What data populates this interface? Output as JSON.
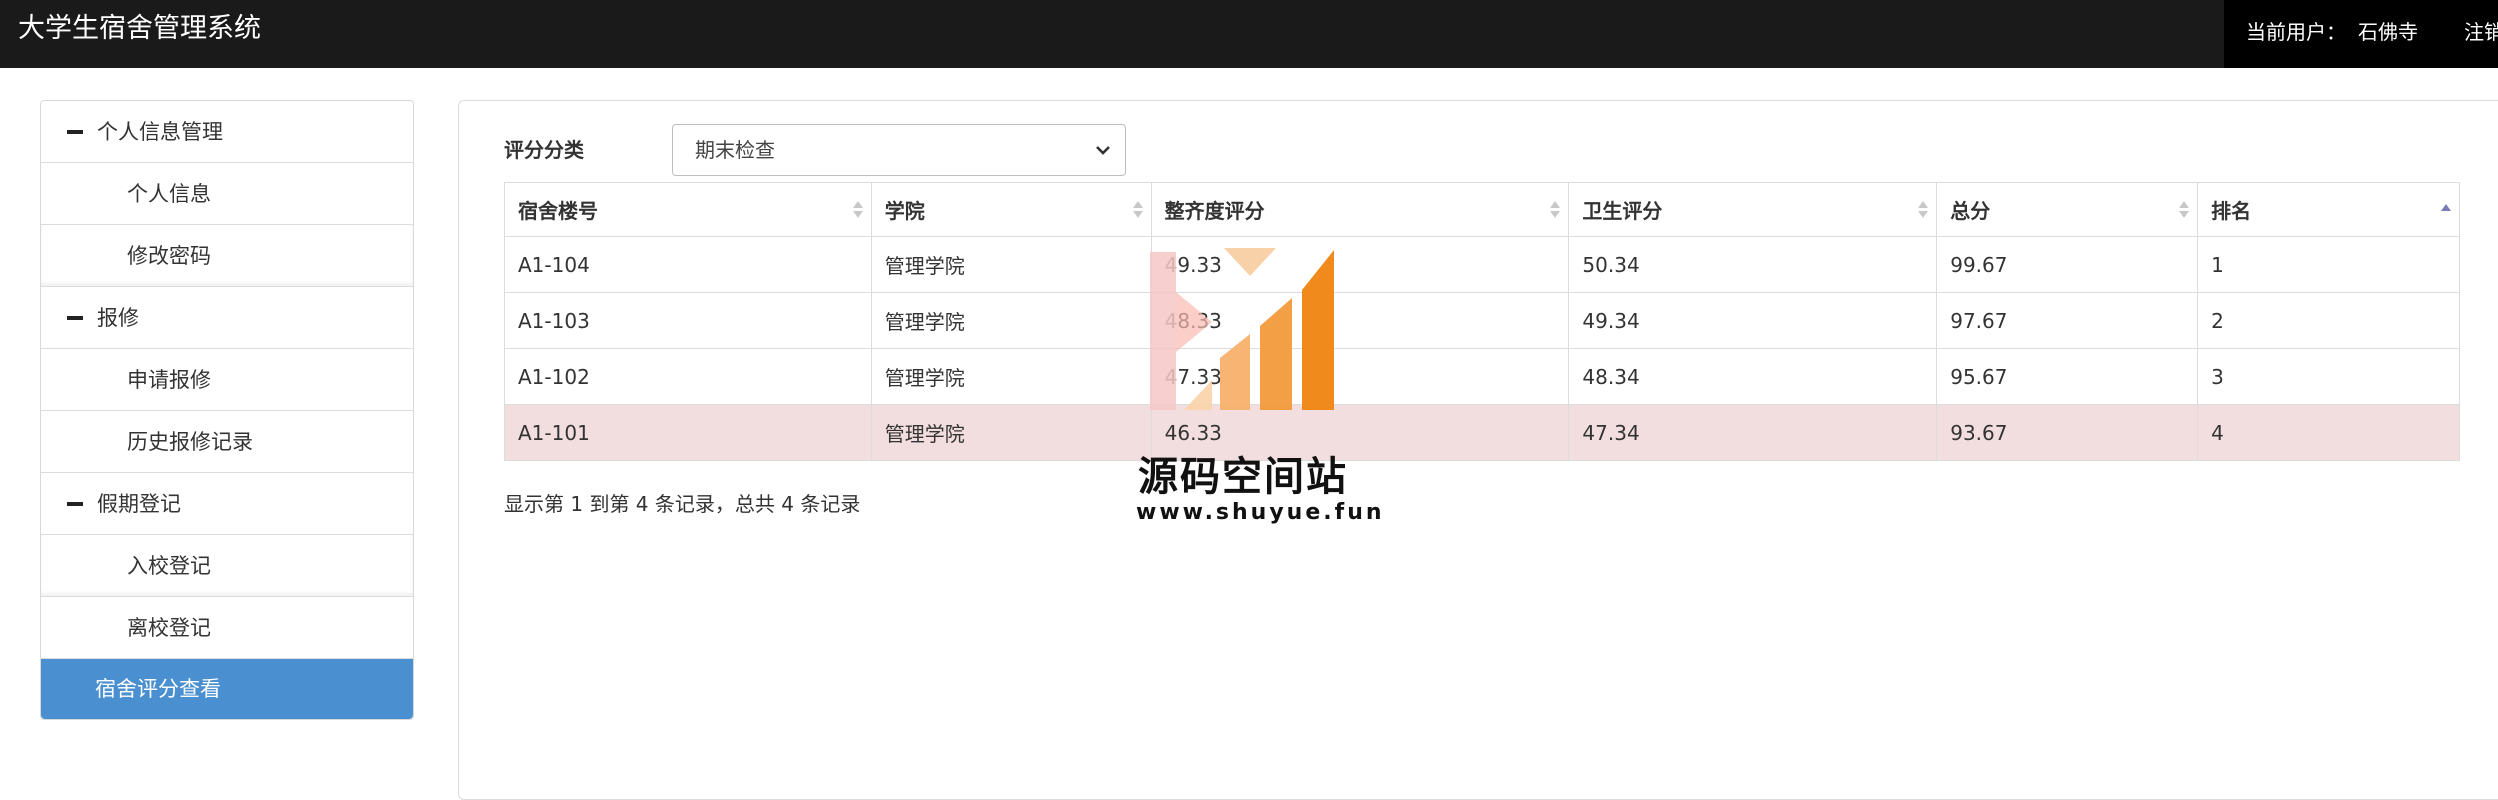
{
  "header": {
    "title": "大学生宿舍管理系统",
    "current_user_label": "当前用户：",
    "current_user": "石佛寺",
    "logout": "注销"
  },
  "sidebar": {
    "groups": [
      {
        "label": "个人信息管理",
        "items": [
          "个人信息",
          "修改密码"
        ]
      },
      {
        "label": "报修",
        "items": [
          "申请报修",
          "历史报修记录"
        ]
      },
      {
        "label": "假期登记",
        "items": [
          "入校登记",
          "离校登记"
        ]
      }
    ],
    "active_item": "宿舍评分查看"
  },
  "filter": {
    "label": "评分分类",
    "selected": "期末检查"
  },
  "table": {
    "columns": [
      "宿舍楼号",
      "学院",
      "整齐度评分",
      "卫生评分",
      "总分",
      "排名"
    ],
    "rows": [
      [
        "A1-104",
        "管理学院",
        "49.33",
        "50.34",
        "99.67",
        "1"
      ],
      [
        "A1-103",
        "管理学院",
        "48.33",
        "49.34",
        "97.67",
        "2"
      ],
      [
        "A1-102",
        "管理学院",
        "47.33",
        "48.34",
        "95.67",
        "3"
      ],
      [
        "A1-101",
        "管理学院",
        "46.33",
        "47.34",
        "93.67",
        "4"
      ]
    ],
    "highlight_row": 3
  },
  "pagination": {
    "summary": "显示第 1 到第 4 条记录，总共 4 条记录"
  },
  "watermark": {
    "title": "源码空间站",
    "url": "www.shuyue.fun"
  },
  "colors": {
    "header_bg": "#1a1a1a",
    "active_item_bg": "#4a8fd0",
    "highlight_row_bg": "#f2dede",
    "watermark_orange": "#f08a1c"
  }
}
